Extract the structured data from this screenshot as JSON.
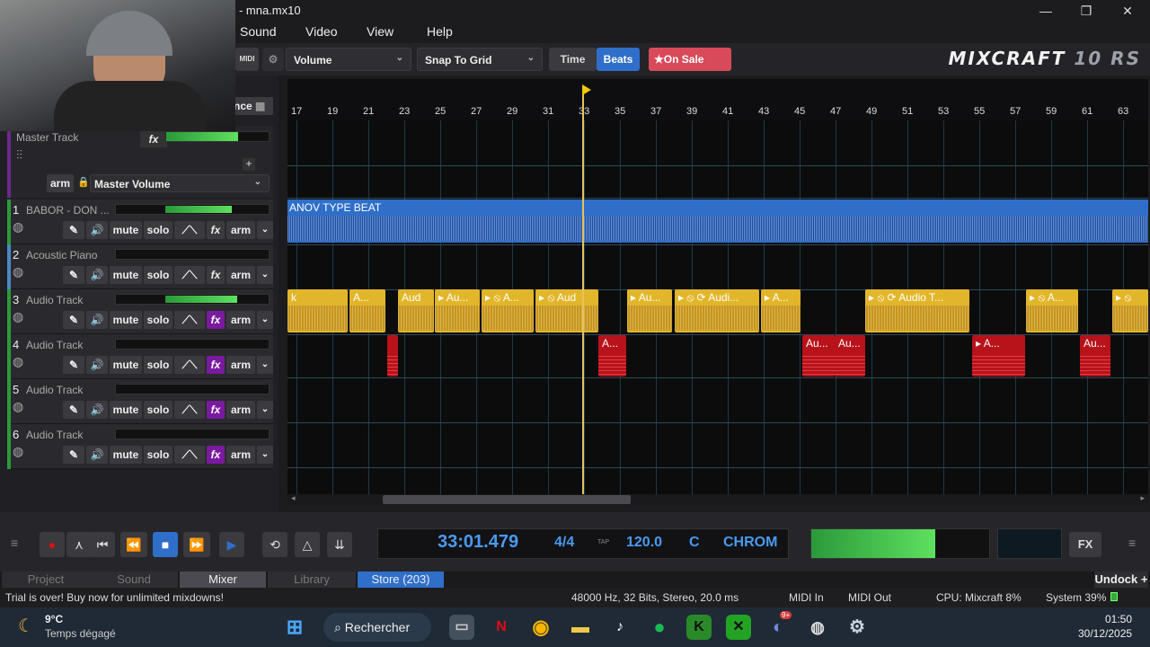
{
  "window": {
    "title": "mna.mx10",
    "minimize": "—",
    "maximize": "❐",
    "close": "✕"
  },
  "menu": [
    "Sound",
    "Video",
    "View",
    "Help"
  ],
  "toolbar": {
    "midi_label": "MIDI",
    "volume_combo": "Volume",
    "snap_combo": "Snap To Grid",
    "time_btn": "Time",
    "beats_btn": "Beats",
    "onsale_btn": "On Sale",
    "logo_main": "MIXCRAFT",
    "logo_ver": "10 RS"
  },
  "master": {
    "partial_btn": "nce",
    "name": "Master Track",
    "fx": "fx",
    "arm": "arm",
    "volume_combo": "Master Volume",
    "add": "+"
  },
  "tracks": [
    {
      "num": "1",
      "name": "BABOR - DON ...",
      "mute": "mute",
      "solo": "solo",
      "fx": "fx",
      "arm": "arm",
      "fx_active": false
    },
    {
      "num": "2",
      "name": "Acoustic Piano",
      "mute": "mute",
      "solo": "solo",
      "fx": "fx",
      "arm": "arm",
      "fx_active": false
    },
    {
      "num": "3",
      "name": "Audio Track",
      "mute": "mute",
      "solo": "solo",
      "fx": "fx",
      "arm": "arm",
      "fx_active": true
    },
    {
      "num": "4",
      "name": "Audio Track",
      "mute": "mute",
      "solo": "solo",
      "fx": "fx",
      "arm": "arm",
      "fx_active": true
    },
    {
      "num": "5",
      "name": "Audio Track",
      "mute": "mute",
      "solo": "solo",
      "fx": "fx",
      "arm": "arm",
      "fx_active": true
    },
    {
      "num": "6",
      "name": "Audio Track",
      "mute": "mute",
      "solo": "solo",
      "fx": "fx",
      "arm": "arm",
      "fx_active": true
    }
  ],
  "ruler": [
    "17",
    "19",
    "21",
    "23",
    "25",
    "27",
    "29",
    "31",
    "33",
    "35",
    "37",
    "39",
    "41",
    "43",
    "45",
    "47",
    "49",
    "51",
    "53",
    "55",
    "57",
    "59",
    "61",
    "63"
  ],
  "track1_clip": "ANOV TYPE BEAT",
  "clips_track3": [
    "k",
    "A...",
    "Aud",
    "▸ Au...",
    "▸ ⦸ A...",
    "▸ ⦸ Aud",
    "▸ Au...",
    "▸ ⦸ ⟳ Audi...",
    "▸ A...",
    "▸ ⦸ ⟳ Audio T...",
    "▸ ⦸ A...",
    "▸ ⦸"
  ],
  "clips_track4": [
    "",
    "A...",
    "Au...",
    "Au...",
    "▸ A...",
    "Au..."
  ],
  "transport": {
    "time": "33:01.479",
    "signature": "4/4",
    "tap": "TAP",
    "tempo": "120.0",
    "key": "C",
    "scale": "CHROM",
    "fx": "FX"
  },
  "tabs": {
    "project": "Project",
    "sound": "Sound",
    "mixer": "Mixer",
    "library": "Library",
    "store": "Store (203)",
    "undock": "Undock"
  },
  "status": {
    "message": "Trial is over!  Buy now for unlimited mixdowns!",
    "audio": "48000 Hz, 32 Bits, Stereo, 20.0 ms",
    "midi_in": "MIDI In",
    "midi_out": "MIDI Out",
    "cpu": "CPU: Mixcraft 8%",
    "system": "System 39%"
  },
  "taskbar": {
    "temp": "9°C",
    "weather": "Temps dégagé",
    "search": "Rechercher",
    "time": "01:50",
    "date": "30/12/2025",
    "discord_badge": "9+"
  },
  "colors": {
    "accent_blue": "#2f6fc9",
    "clip_yellow": "#e2b62a",
    "clip_red": "#b8121a",
    "fx_purple": "#7a1aa0",
    "onsale_red": "#d84a5a"
  }
}
